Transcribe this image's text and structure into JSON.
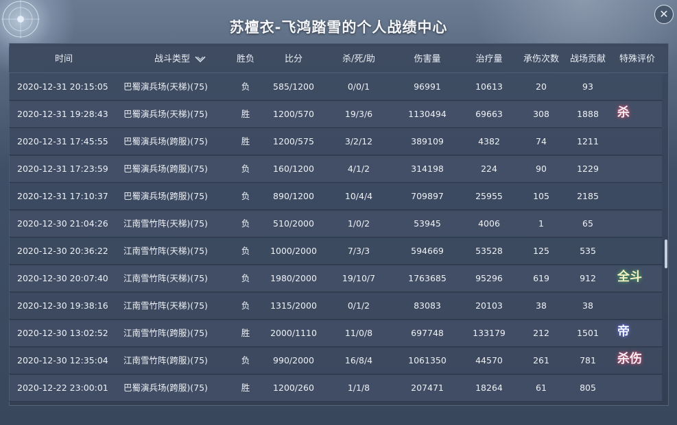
{
  "window": {
    "title": "苏檀衣-飞鸿踏雪的个人战绩中心",
    "close_label": "✕"
  },
  "table": {
    "headers": [
      "时间",
      "战斗类型",
      "胜负",
      "比分",
      "杀/死/助",
      "伤害量",
      "治疗量",
      "承伤次数",
      "战场贡献",
      "特殊评价"
    ],
    "rows": [
      {
        "time": "2020-12-31 20:15:05",
        "type": "巴蜀演兵场(天梯)(75)",
        "result": "负",
        "score": "585/1200",
        "kda": "0/0/1",
        "damage": "96991",
        "heal": "10613",
        "hits": "20",
        "contrib": "93",
        "rating": ""
      },
      {
        "time": "2020-12-31 19:28:43",
        "type": "巴蜀演兵场(天梯)(75)",
        "result": "胜",
        "score": "1200/570",
        "kda": "19/3/6",
        "damage": "1130494",
        "heal": "69663",
        "hits": "308",
        "contrib": "1888",
        "rating": "杀"
      },
      {
        "time": "2020-12-31 17:45:55",
        "type": "巴蜀演兵场(跨服)(75)",
        "result": "胜",
        "score": "1200/575",
        "kda": "3/2/12",
        "damage": "389109",
        "heal": "4382",
        "hits": "74",
        "contrib": "1211",
        "rating": ""
      },
      {
        "time": "2020-12-31 17:23:59",
        "type": "巴蜀演兵场(跨服)(75)",
        "result": "负",
        "score": "160/1200",
        "kda": "4/1/2",
        "damage": "314198",
        "heal": "224",
        "hits": "90",
        "contrib": "1229",
        "rating": ""
      },
      {
        "time": "2020-12-31 17:10:37",
        "type": "巴蜀演兵场(跨服)(75)",
        "result": "负",
        "score": "890/1200",
        "kda": "10/4/4",
        "damage": "709897",
        "heal": "25955",
        "hits": "105",
        "contrib": "2185",
        "rating": ""
      },
      {
        "time": "2020-12-30 21:04:26",
        "type": "江南雪竹阵(天梯)(75)",
        "result": "负",
        "score": "510/2000",
        "kda": "1/0/2",
        "damage": "53945",
        "heal": "4006",
        "hits": "1",
        "contrib": "65",
        "rating": ""
      },
      {
        "time": "2020-12-30 20:36:22",
        "type": "江南雪竹阵(天梯)(75)",
        "result": "负",
        "score": "1000/2000",
        "kda": "7/3/3",
        "damage": "594669",
        "heal": "53528",
        "hits": "125",
        "contrib": "535",
        "rating": ""
      },
      {
        "time": "2020-12-30 20:07:40",
        "type": "江南雪竹阵(天梯)(75)",
        "result": "负",
        "score": "1980/2000",
        "kda": "19/10/7",
        "damage": "1763685",
        "heal": "95296",
        "hits": "619",
        "contrib": "912",
        "rating": "全斗"
      },
      {
        "time": "2020-12-30 19:38:16",
        "type": "江南雪竹阵(天梯)(75)",
        "result": "负",
        "score": "1315/2000",
        "kda": "0/1/2",
        "damage": "83083",
        "heal": "20103",
        "hits": "38",
        "contrib": "38",
        "rating": ""
      },
      {
        "time": "2020-12-30 13:02:52",
        "type": "江南雪竹阵(跨服)(75)",
        "result": "胜",
        "score": "2000/1110",
        "kda": "11/0/8",
        "damage": "697748",
        "heal": "133179",
        "hits": "212",
        "contrib": "1501",
        "rating": "帝"
      },
      {
        "time": "2020-12-30 12:35:04",
        "type": "江南雪竹阵(跨服)(75)",
        "result": "负",
        "score": "990/2000",
        "kda": "16/8/4",
        "damage": "1061350",
        "heal": "44570",
        "hits": "261",
        "contrib": "781",
        "rating": "杀伤"
      },
      {
        "time": "2020-12-22 23:00:01",
        "type": "巴蜀演兵场(跨服)(75)",
        "result": "胜",
        "score": "1200/260",
        "kda": "1/1/8",
        "damage": "207471",
        "heal": "18264",
        "hits": "61",
        "contrib": "805",
        "rating": ""
      }
    ]
  },
  "badges": [
    {
      "text": "杀",
      "style": "red"
    },
    {
      "text": "全斗",
      "style": "gold"
    },
    {
      "text": "帝",
      "style": "blue"
    },
    {
      "text": "杀伤",
      "style": "red"
    }
  ],
  "colors": {
    "panel": "#3a465c",
    "text": "#eef1f6",
    "badge_glow": "#c0486a"
  }
}
